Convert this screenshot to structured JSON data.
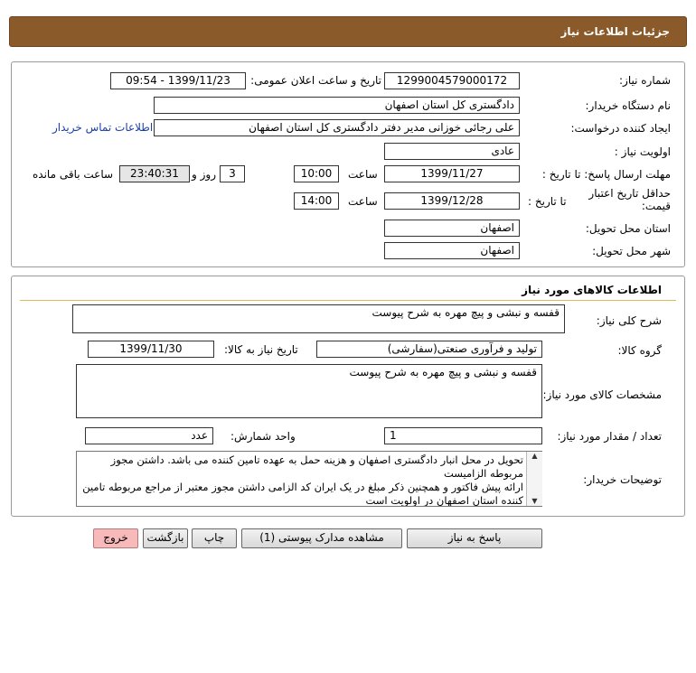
{
  "header": {
    "title": "جزئیات اطلاعات نیاز"
  },
  "labels": {
    "need_no": "شماره نیاز:",
    "announce_dt": "تاریخ و ساعت اعلان عمومی:",
    "buyer_org": "نام دستگاه خریدار:",
    "creator": "ایجاد کننده درخواست:",
    "contact_link": "اطلاعات تماس خریدار",
    "priority": "اولویت نیاز :",
    "send_deadline": "مهلت ارسال پاسخ: تا تاریخ :",
    "time1": "ساعت",
    "days_and": "روز و",
    "remaining": "ساعت باقی مانده",
    "price_validity": "حداقل تاریخ اعتبار قیمت:",
    "until_date": "تا تاریخ :",
    "time2": "ساعت",
    "province": "استان محل تحویل:",
    "city": "شهر محل تحویل:"
  },
  "values": {
    "need_no": "1299004579000172",
    "announce_dt": "1399/11/23 - 09:54",
    "buyer_org": "دادگستری کل استان اصفهان",
    "creator": "علی رجائی خوزانی مدیر دفتر دادگستری کل استان اصفهان",
    "priority": "عادی",
    "send_date": "1399/11/27",
    "send_time": "10:00",
    "days": "3",
    "remaining": "23:40:31",
    "validity_date": "1399/12/28",
    "validity_time": "14:00",
    "province": "اصفهان",
    "city": "اصفهان"
  },
  "goods": {
    "title": "اطلاعات کالاهای مورد نیاز",
    "summary_label": "شرح کلی نیاز:",
    "summary": "قفسه و نبشی و پیچ مهره به شرح پیوست",
    "group_label": "گروه کالا:",
    "group": "تولید و فرآوری صنعتی(سفارشی)",
    "need_date_label": "تاریخ نیاز به کالا:",
    "need_date": "1399/11/30",
    "spec_label": "مشخصات کالای مورد نیاز:",
    "spec": "قفسه و نبشی و پیچ مهره به شرح پیوست",
    "qty_label": "تعداد / مقدار مورد نیاز:",
    "qty": "1",
    "unit_label": "واحد شمارش:",
    "unit": "عدد",
    "buyer_notes_label": "توضیحات خریدار:",
    "notes_1": "تحویل در محل انبار دادگستری اصفهان و هزینه حمل به عهده تامین کننده می باشد. داشتن مجوز مربوطه الزامیست",
    "notes_2": "ارائه پیش فاکتور و همچنین ذکر مبلغ در یک ایران کد الزامی  داشتن مجوز معتبر از مراجع مربوطه تامین کننده استان اصفهان در اولویت است"
  },
  "buttons": {
    "reply": "پاسخ به نیاز",
    "attachments": "مشاهده مدارک پیوستی (1)",
    "print": "چاپ",
    "back": "بازگشت",
    "exit": "خروج"
  },
  "colors": {
    "header_bg": "#8a5a2b",
    "exit_bg": "#f7b9b9"
  }
}
